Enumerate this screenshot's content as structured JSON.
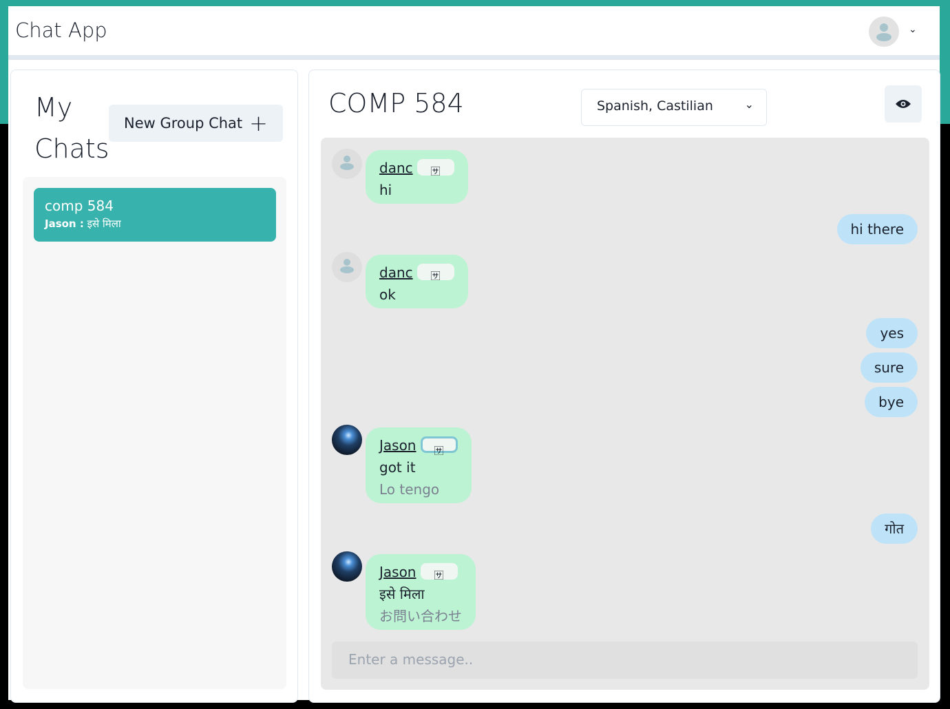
{
  "header": {
    "title": "Chat App",
    "avatar_icon": "user-icon",
    "menu_icon": "chevron-down-icon"
  },
  "sidebar": {
    "title": "My Chats",
    "new_group_label": "New Group Chat",
    "chats": [
      {
        "name": "comp 584",
        "latest_sender": "Jason :",
        "latest_message": "इसे मिला"
      }
    ]
  },
  "chat": {
    "title": "COMP 584",
    "language": "Spanish, Castilian",
    "view_icon": "eye-icon",
    "messages": [
      {
        "sender": "danc",
        "text": "hi",
        "mine": false
      },
      {
        "text": "hi there",
        "mine": true
      },
      {
        "sender": "danc",
        "text": "ok",
        "mine": false
      },
      {
        "text": "yes",
        "mine": true
      },
      {
        "text": "sure",
        "mine": true
      },
      {
        "text": "bye",
        "mine": true
      },
      {
        "sender": "Jason",
        "text": "got it",
        "translation": "Lo tengo",
        "mine": false
      },
      {
        "text": "गोत",
        "mine": true
      },
      {
        "sender": "Jason",
        "text": "इसे मिला",
        "translation": "お問い合わせ",
        "mine": false
      }
    ],
    "input_placeholder": "Enter a message.."
  },
  "colors": {
    "accent": "#38b2ac",
    "received": "#bbf3d3",
    "sent": "#bee3f8"
  }
}
